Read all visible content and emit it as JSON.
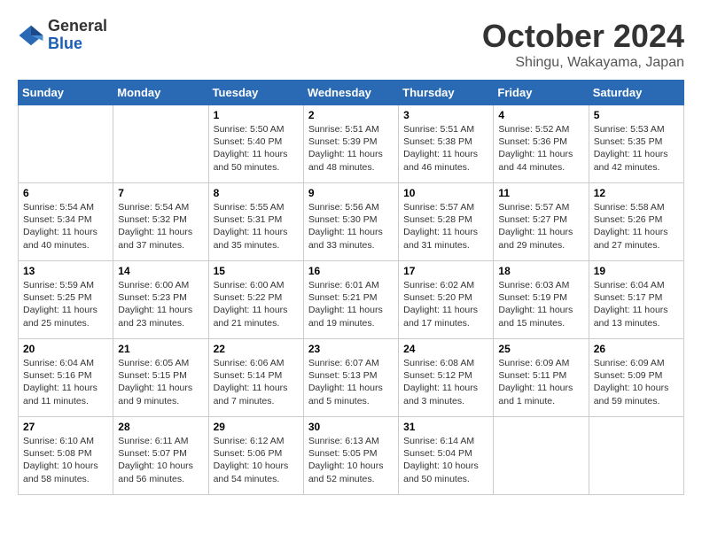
{
  "header": {
    "logo_general": "General",
    "logo_blue": "Blue",
    "month_title": "October 2024",
    "subtitle": "Shingu, Wakayama, Japan"
  },
  "weekdays": [
    "Sunday",
    "Monday",
    "Tuesday",
    "Wednesday",
    "Thursday",
    "Friday",
    "Saturday"
  ],
  "weeks": [
    [
      {
        "day": "",
        "sunrise": "",
        "sunset": "",
        "daylight": ""
      },
      {
        "day": "",
        "sunrise": "",
        "sunset": "",
        "daylight": ""
      },
      {
        "day": "1",
        "sunrise": "Sunrise: 5:50 AM",
        "sunset": "Sunset: 5:40 PM",
        "daylight": "Daylight: 11 hours and 50 minutes."
      },
      {
        "day": "2",
        "sunrise": "Sunrise: 5:51 AM",
        "sunset": "Sunset: 5:39 PM",
        "daylight": "Daylight: 11 hours and 48 minutes."
      },
      {
        "day": "3",
        "sunrise": "Sunrise: 5:51 AM",
        "sunset": "Sunset: 5:38 PM",
        "daylight": "Daylight: 11 hours and 46 minutes."
      },
      {
        "day": "4",
        "sunrise": "Sunrise: 5:52 AM",
        "sunset": "Sunset: 5:36 PM",
        "daylight": "Daylight: 11 hours and 44 minutes."
      },
      {
        "day": "5",
        "sunrise": "Sunrise: 5:53 AM",
        "sunset": "Sunset: 5:35 PM",
        "daylight": "Daylight: 11 hours and 42 minutes."
      }
    ],
    [
      {
        "day": "6",
        "sunrise": "Sunrise: 5:54 AM",
        "sunset": "Sunset: 5:34 PM",
        "daylight": "Daylight: 11 hours and 40 minutes."
      },
      {
        "day": "7",
        "sunrise": "Sunrise: 5:54 AM",
        "sunset": "Sunset: 5:32 PM",
        "daylight": "Daylight: 11 hours and 37 minutes."
      },
      {
        "day": "8",
        "sunrise": "Sunrise: 5:55 AM",
        "sunset": "Sunset: 5:31 PM",
        "daylight": "Daylight: 11 hours and 35 minutes."
      },
      {
        "day": "9",
        "sunrise": "Sunrise: 5:56 AM",
        "sunset": "Sunset: 5:30 PM",
        "daylight": "Daylight: 11 hours and 33 minutes."
      },
      {
        "day": "10",
        "sunrise": "Sunrise: 5:57 AM",
        "sunset": "Sunset: 5:28 PM",
        "daylight": "Daylight: 11 hours and 31 minutes."
      },
      {
        "day": "11",
        "sunrise": "Sunrise: 5:57 AM",
        "sunset": "Sunset: 5:27 PM",
        "daylight": "Daylight: 11 hours and 29 minutes."
      },
      {
        "day": "12",
        "sunrise": "Sunrise: 5:58 AM",
        "sunset": "Sunset: 5:26 PM",
        "daylight": "Daylight: 11 hours and 27 minutes."
      }
    ],
    [
      {
        "day": "13",
        "sunrise": "Sunrise: 5:59 AM",
        "sunset": "Sunset: 5:25 PM",
        "daylight": "Daylight: 11 hours and 25 minutes."
      },
      {
        "day": "14",
        "sunrise": "Sunrise: 6:00 AM",
        "sunset": "Sunset: 5:23 PM",
        "daylight": "Daylight: 11 hours and 23 minutes."
      },
      {
        "day": "15",
        "sunrise": "Sunrise: 6:00 AM",
        "sunset": "Sunset: 5:22 PM",
        "daylight": "Daylight: 11 hours and 21 minutes."
      },
      {
        "day": "16",
        "sunrise": "Sunrise: 6:01 AM",
        "sunset": "Sunset: 5:21 PM",
        "daylight": "Daylight: 11 hours and 19 minutes."
      },
      {
        "day": "17",
        "sunrise": "Sunrise: 6:02 AM",
        "sunset": "Sunset: 5:20 PM",
        "daylight": "Daylight: 11 hours and 17 minutes."
      },
      {
        "day": "18",
        "sunrise": "Sunrise: 6:03 AM",
        "sunset": "Sunset: 5:19 PM",
        "daylight": "Daylight: 11 hours and 15 minutes."
      },
      {
        "day": "19",
        "sunrise": "Sunrise: 6:04 AM",
        "sunset": "Sunset: 5:17 PM",
        "daylight": "Daylight: 11 hours and 13 minutes."
      }
    ],
    [
      {
        "day": "20",
        "sunrise": "Sunrise: 6:04 AM",
        "sunset": "Sunset: 5:16 PM",
        "daylight": "Daylight: 11 hours and 11 minutes."
      },
      {
        "day": "21",
        "sunrise": "Sunrise: 6:05 AM",
        "sunset": "Sunset: 5:15 PM",
        "daylight": "Daylight: 11 hours and 9 minutes."
      },
      {
        "day": "22",
        "sunrise": "Sunrise: 6:06 AM",
        "sunset": "Sunset: 5:14 PM",
        "daylight": "Daylight: 11 hours and 7 minutes."
      },
      {
        "day": "23",
        "sunrise": "Sunrise: 6:07 AM",
        "sunset": "Sunset: 5:13 PM",
        "daylight": "Daylight: 11 hours and 5 minutes."
      },
      {
        "day": "24",
        "sunrise": "Sunrise: 6:08 AM",
        "sunset": "Sunset: 5:12 PM",
        "daylight": "Daylight: 11 hours and 3 minutes."
      },
      {
        "day": "25",
        "sunrise": "Sunrise: 6:09 AM",
        "sunset": "Sunset: 5:11 PM",
        "daylight": "Daylight: 11 hours and 1 minute."
      },
      {
        "day": "26",
        "sunrise": "Sunrise: 6:09 AM",
        "sunset": "Sunset: 5:09 PM",
        "daylight": "Daylight: 10 hours and 59 minutes."
      }
    ],
    [
      {
        "day": "27",
        "sunrise": "Sunrise: 6:10 AM",
        "sunset": "Sunset: 5:08 PM",
        "daylight": "Daylight: 10 hours and 58 minutes."
      },
      {
        "day": "28",
        "sunrise": "Sunrise: 6:11 AM",
        "sunset": "Sunset: 5:07 PM",
        "daylight": "Daylight: 10 hours and 56 minutes."
      },
      {
        "day": "29",
        "sunrise": "Sunrise: 6:12 AM",
        "sunset": "Sunset: 5:06 PM",
        "daylight": "Daylight: 10 hours and 54 minutes."
      },
      {
        "day": "30",
        "sunrise": "Sunrise: 6:13 AM",
        "sunset": "Sunset: 5:05 PM",
        "daylight": "Daylight: 10 hours and 52 minutes."
      },
      {
        "day": "31",
        "sunrise": "Sunrise: 6:14 AM",
        "sunset": "Sunset: 5:04 PM",
        "daylight": "Daylight: 10 hours and 50 minutes."
      },
      {
        "day": "",
        "sunrise": "",
        "sunset": "",
        "daylight": ""
      },
      {
        "day": "",
        "sunrise": "",
        "sunset": "",
        "daylight": ""
      }
    ]
  ]
}
